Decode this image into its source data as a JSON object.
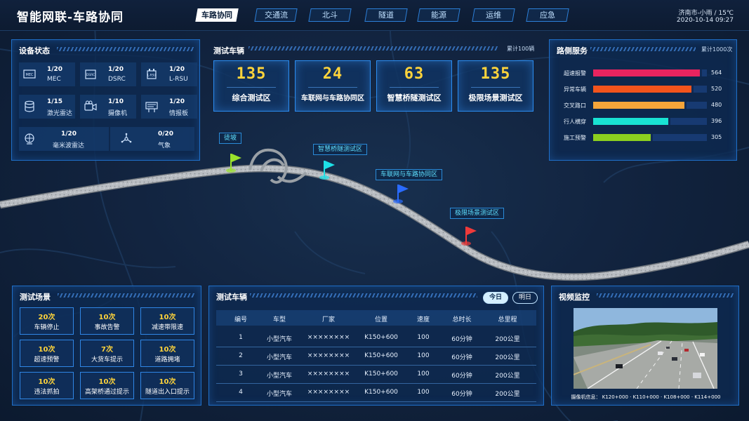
{
  "header": {
    "title": "智能网联-车路协同",
    "tabs": [
      {
        "label": "车路协同",
        "active": true
      },
      {
        "label": "交通流",
        "active": false
      },
      {
        "label": "北斗",
        "active": false
      },
      {
        "label": "隧道",
        "active": false
      },
      {
        "label": "能源",
        "active": false
      },
      {
        "label": "运维",
        "active": false
      },
      {
        "label": "应急",
        "active": false
      }
    ],
    "weather": "济南市-小雨 / 15℃",
    "datetime": "2020-10-14  09:27"
  },
  "device_status": {
    "title": "设备状态",
    "items": [
      {
        "count": "1/20",
        "name": "MEC",
        "icon": "mec-device-icon"
      },
      {
        "count": "1/20",
        "name": "DSRC",
        "icon": "dsrc-device-icon"
      },
      {
        "count": "1/20",
        "name": "L-RSU",
        "icon": "rsu-device-icon"
      },
      {
        "count": "1/15",
        "name": "激光雷达",
        "icon": "lidar-icon"
      },
      {
        "count": "1/10",
        "name": "摄像机",
        "icon": "camera-icon"
      },
      {
        "count": "1/20",
        "name": "情报板",
        "icon": "info-board-icon"
      },
      {
        "count": "1/20",
        "name": "毫米波雷达",
        "icon": "mmwave-radar-icon"
      },
      {
        "count": "0/20",
        "name": "气象",
        "icon": "weather-station-icon"
      }
    ]
  },
  "test_vehicles": {
    "title": "测试车辆",
    "note": "累计100辆",
    "cards": [
      {
        "value": "135",
        "label": "综合测试区"
      },
      {
        "value": "24",
        "label": "车联网与车路协同区"
      },
      {
        "value": "63",
        "label": "智慧桥隧测试区"
      },
      {
        "value": "135",
        "label": "极限场景测试区"
      }
    ]
  },
  "roadside": {
    "title": "路侧服务",
    "note": "累计1000次",
    "max": 600,
    "items": [
      {
        "label": "超速报警",
        "value": 564,
        "color": "#e8245f"
      },
      {
        "label": "异常车辆",
        "value": 520,
        "color": "#f2541c"
      },
      {
        "label": "交叉路口",
        "value": 480,
        "color": "#f5a53a"
      },
      {
        "label": "行人横穿",
        "value": 396,
        "color": "#19e3d3"
      },
      {
        "label": "施工预警",
        "value": 305,
        "color": "#8ccf1f"
      }
    ]
  },
  "map": {
    "markers": [
      {
        "label": "徒坡",
        "color": "#9be22c"
      },
      {
        "label": "智慧桥隧测试区",
        "color": "#1de0e6"
      },
      {
        "label": "车联网与车路协同区",
        "color": "#2a6bff"
      },
      {
        "label": "极限场景测试区",
        "color": "#f03a3a"
      }
    ]
  },
  "scenes": {
    "title": "测试场景",
    "items": [
      {
        "count": "20次",
        "name": "车辆停止"
      },
      {
        "count": "10次",
        "name": "事故告警"
      },
      {
        "count": "10次",
        "name": "减速带限速"
      },
      {
        "count": "10次",
        "name": "超速预警"
      },
      {
        "count": "7次",
        "name": "大货车提示"
      },
      {
        "count": "10次",
        "name": "道路拥堵"
      },
      {
        "count": "10次",
        "name": "违法抓拍"
      },
      {
        "count": "10次",
        "name": "高架桥通过提示"
      },
      {
        "count": "10次",
        "name": "隧道出入口提示"
      }
    ]
  },
  "vehicle_table": {
    "title": "测试车辆",
    "toggles": [
      {
        "label": "今日",
        "active": true
      },
      {
        "label": "明日",
        "active": false
      }
    ],
    "columns": [
      "编号",
      "车型",
      "厂家",
      "位置",
      "速度",
      "总时长",
      "总里程"
    ],
    "rows": [
      [
        "1",
        "小型汽车",
        "××××××××",
        "K150+600",
        "100",
        "60分钟",
        "200公里"
      ],
      [
        "2",
        "小型汽车",
        "××××××××",
        "K150+600",
        "100",
        "60分钟",
        "200公里"
      ],
      [
        "3",
        "小型汽车",
        "××××××××",
        "K150+600",
        "100",
        "60分钟",
        "200公里"
      ],
      [
        "4",
        "小型汽车",
        "××××××××",
        "K150+600",
        "100",
        "60分钟",
        "200公里"
      ]
    ]
  },
  "video": {
    "title": "视频监控",
    "camera_info": "摄像机信息：  K120+000  ·  K110+000  ·  K108+000  ·  K114+000"
  }
}
